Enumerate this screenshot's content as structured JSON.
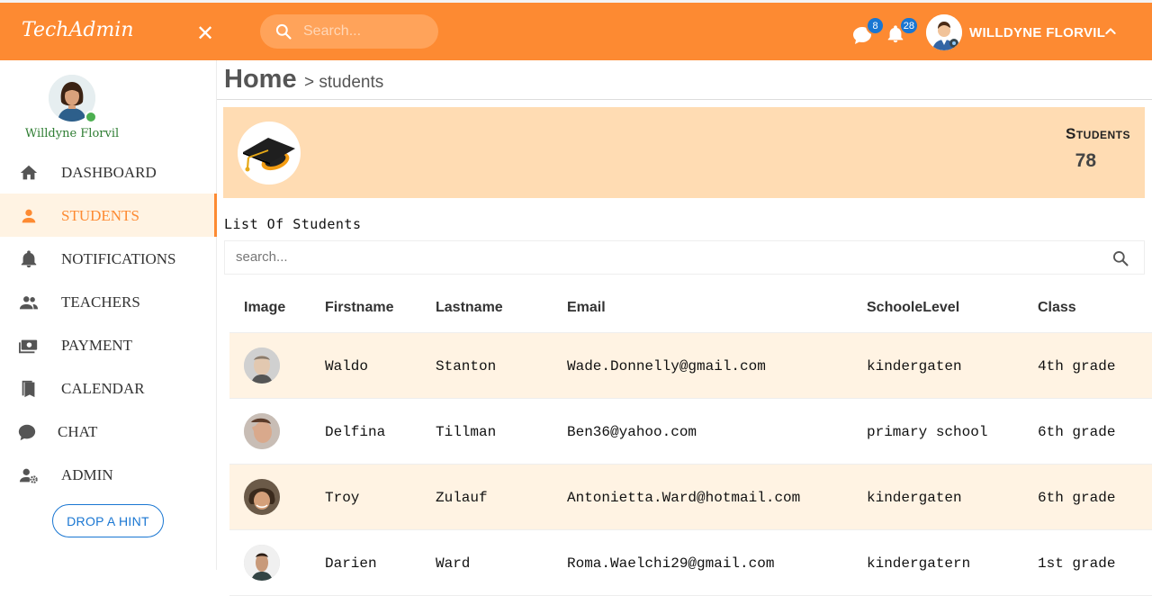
{
  "app": {
    "title": "TechAdmin"
  },
  "header": {
    "search_placeholder": "Search...",
    "messages_count": "8",
    "notifications_count": "28",
    "user_name": "WILLDYNE FLORVIL"
  },
  "sidebar": {
    "profile_name": "Willdyne Florvil",
    "items": [
      {
        "label": "DASHBOARD",
        "icon": "home-icon"
      },
      {
        "label": "STUDENTS",
        "icon": "person-icon"
      },
      {
        "label": "NOTIFICATIONS",
        "icon": "bell-icon"
      },
      {
        "label": "TEACHERS",
        "icon": "people-icon"
      },
      {
        "label": "PAYMENT",
        "icon": "money-icon"
      },
      {
        "label": "CALENDAR",
        "icon": "bookmarks-icon"
      },
      {
        "label": "CHAT",
        "icon": "chat-icon"
      },
      {
        "label": "ADMIN",
        "icon": "admin-icon"
      }
    ],
    "active": "STUDENTS",
    "hint_button": "DROP A HINT"
  },
  "breadcrumb": {
    "home": "Home",
    "current": "> students"
  },
  "stat": {
    "title": "Students",
    "count": "78"
  },
  "list": {
    "title": "List Of Students",
    "search_placeholder": "search...",
    "columns": [
      "Image",
      "Firstname",
      "Lastname",
      "Email",
      "SchooleLevel",
      "Class"
    ],
    "rows": [
      {
        "firstname": "Waldo",
        "lastname": "Stanton",
        "email": "Wade.Donnelly@gmail.com",
        "level": "kindergaten",
        "class": "4th grade"
      },
      {
        "firstname": "Delfina",
        "lastname": "Tillman",
        "email": "Ben36@yahoo.com",
        "level": "primary school",
        "class": "6th grade"
      },
      {
        "firstname": "Troy",
        "lastname": "Zulauf",
        "email": "Antonietta.Ward@hotmail.com",
        "level": "kindergaten",
        "class": "6th grade"
      },
      {
        "firstname": "Darien",
        "lastname": "Ward",
        "email": "Roma.Waelchi29@gmail.com",
        "level": "kindergatern",
        "class": "1st grade"
      }
    ]
  },
  "colors": {
    "accent": "#fd8a32",
    "accent_light": "#fff3e3",
    "card": "#ffdcb3",
    "badge": "#1976d2",
    "online": "#4caf50"
  }
}
